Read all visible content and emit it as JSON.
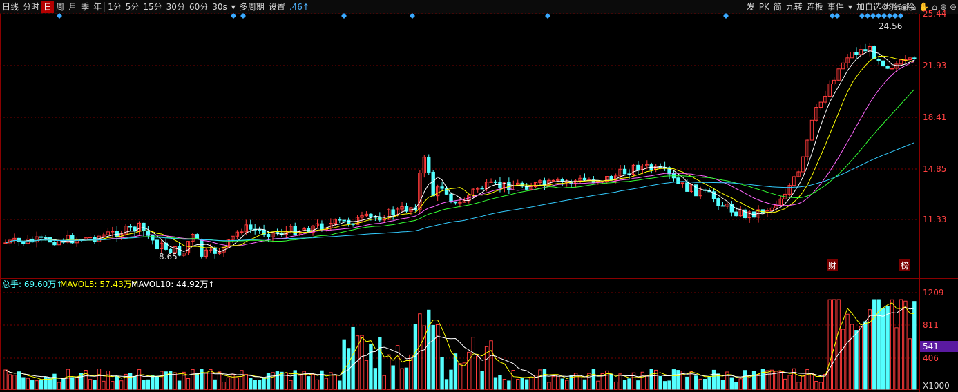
{
  "toolbar": {
    "left_items": [
      "日线",
      "分时",
      "日",
      "周",
      "月",
      "季",
      "年",
      "1分",
      "5分",
      "15分",
      "30分",
      "60分",
      "30s",
      "多周期",
      "设置"
    ],
    "active_item": "日",
    "value_text": ".46↑",
    "right_items": [
      "发",
      "PK",
      "简",
      "九转",
      "连板",
      "事件",
      "加自选",
      "均线",
      "除"
    ]
  },
  "price_panel": {
    "axis_ticks": [
      "25.44",
      "21.93",
      "18.41",
      "14.85",
      "11.33"
    ],
    "max_label": "24.56",
    "min_label": "8.65",
    "markers": {
      "cai": "财",
      "bang": "榜"
    }
  },
  "volume_panel": {
    "legend": {
      "total": "总手: 69.60万↑",
      "mavol5": "MAVOL5: 57.43万↑",
      "mavol10": "MAVOL10: 44.92万↑"
    },
    "axis_ticks": [
      "1209",
      "811",
      "406"
    ],
    "highlight_value": "541",
    "unit": "X1000"
  },
  "colors": {
    "up": "#ff3b3b",
    "down": "#54ffff",
    "ma5": "#ffffff",
    "ma10": "#ffff00",
    "ma20": "#ff66ff",
    "ma30": "#33ff33",
    "ma60": "#33ccff",
    "grid": "#7a0000"
  }
}
